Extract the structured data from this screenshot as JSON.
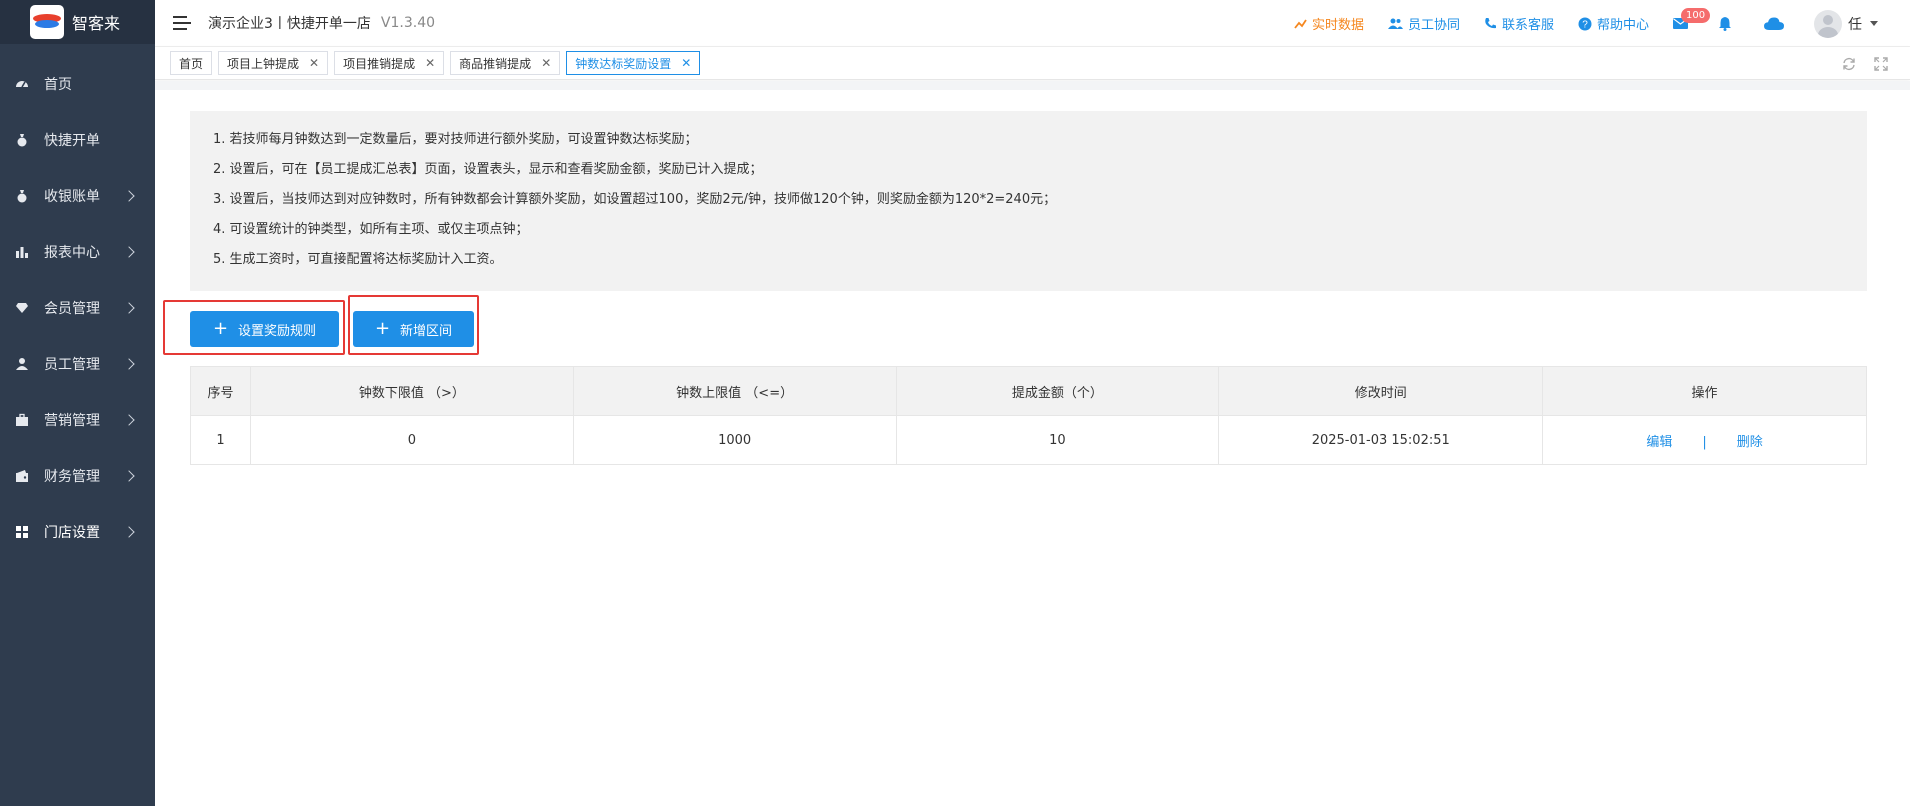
{
  "brand": {
    "name": "智客来"
  },
  "sidebar": {
    "items": [
      {
        "label": "首页",
        "icon": "dashboard-icon",
        "expandable": false
      },
      {
        "label": "快捷开单",
        "icon": "money-bag-icon",
        "expandable": false
      },
      {
        "label": "收银账单",
        "icon": "money-bag-icon",
        "expandable": true
      },
      {
        "label": "报表中心",
        "icon": "bar-chart-icon",
        "expandable": true
      },
      {
        "label": "会员管理",
        "icon": "diamond-icon",
        "expandable": true
      },
      {
        "label": "员工管理",
        "icon": "user-icon",
        "expandable": true
      },
      {
        "label": "营销管理",
        "icon": "briefcase-icon",
        "expandable": true
      },
      {
        "label": "财务管理",
        "icon": "wallet-icon",
        "expandable": true
      },
      {
        "label": "门店设置",
        "icon": "grid-icon",
        "expandable": true
      }
    ]
  },
  "header": {
    "title": "演示企业3丨快捷开单一店",
    "version": "V1.3.40",
    "realtime": "实时数据",
    "collab": "员工协同",
    "support": "联系客服",
    "help": "帮助中心",
    "mail_badge": "100",
    "user_name": "任"
  },
  "tabs": [
    {
      "label": "首页",
      "closable": false
    },
    {
      "label": "项目上钟提成",
      "closable": true
    },
    {
      "label": "项目推销提成",
      "closable": true
    },
    {
      "label": "商品推销提成",
      "closable": true
    },
    {
      "label": "钟数达标奖励设置",
      "closable": true,
      "active": true
    }
  ],
  "notice": {
    "lines": [
      "1. 若技师每月钟数达到一定数量后，要对技师进行额外奖励，可设置钟数达标奖励；",
      "2. 设置后，可在【员工提成汇总表】页面，设置表头，显示和查看奖励金额，奖励已计入提成；",
      "3. 设置后，当技师达到对应钟数时，所有钟数都会计算额外奖励，如设置超过100，奖励2元/钟，技师做120个钟，则奖励金额为120*2=240元；",
      "4. 可设置统计的钟类型，如所有主项、或仅主项点钟；",
      "5. 生成工资时，可直接配置将达标奖励计入工资。"
    ]
  },
  "buttons": {
    "set_rule": "设置奖励规则",
    "add_range": "新增区间"
  },
  "table": {
    "headers": [
      "序号",
      "钟数下限值 （>）",
      "钟数上限值 （<=）",
      "提成金额（个）",
      "修改时间",
      "操作"
    ],
    "rows": [
      {
        "index": "1",
        "lower": "0",
        "upper": "1000",
        "amount": "10",
        "modified": "2025-01-03 15:02:51"
      }
    ],
    "edit_label": "编辑",
    "separator": "|",
    "delete_label": "删除"
  },
  "colors": {
    "sidebar_bg": "#2f3c4e",
    "primary": "#1f8fe6",
    "realtime": "#f5871f",
    "highlight": "#e53935",
    "badge": "#f56c6c"
  }
}
